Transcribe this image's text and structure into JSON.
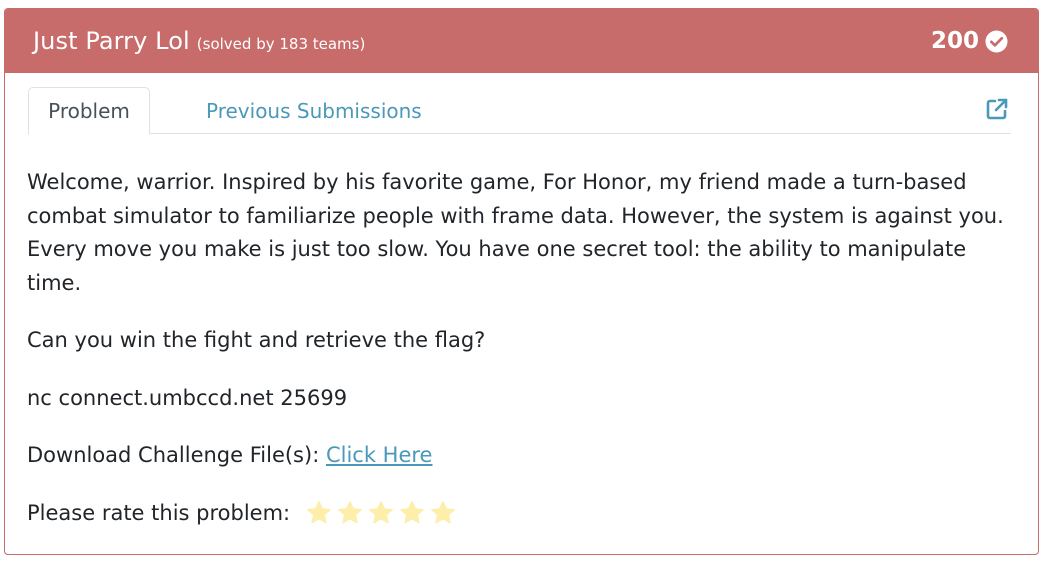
{
  "header": {
    "title": "Just Parry Lol",
    "solved_text": "(solved by 183 teams)",
    "points": "200",
    "bg_color": "#c86b6b"
  },
  "tabs": [
    {
      "label": "Problem",
      "active": true
    },
    {
      "label": "Previous Submissions",
      "active": false
    }
  ],
  "icons": {
    "external": "external-link-icon",
    "solved": "check-circle-icon",
    "star": "star-icon"
  },
  "problem": {
    "description": "Welcome, warrior. Inspired by his favorite game, For Honor, my friend made a turn-based combat simulator to familiarize people with frame data. However, the system is against you. Every move you make is just too slow. You have one secret tool: the ability to manipulate time.",
    "question": "Can you win the fight and retrieve the flag?",
    "connection": "nc connect.umbccd.net 25699",
    "download_label": "Download Challenge File(s):",
    "download_link": "Click Here",
    "rate_label": "Please rate this problem:",
    "star_count": 5,
    "star_color": "#fdeeaa"
  }
}
